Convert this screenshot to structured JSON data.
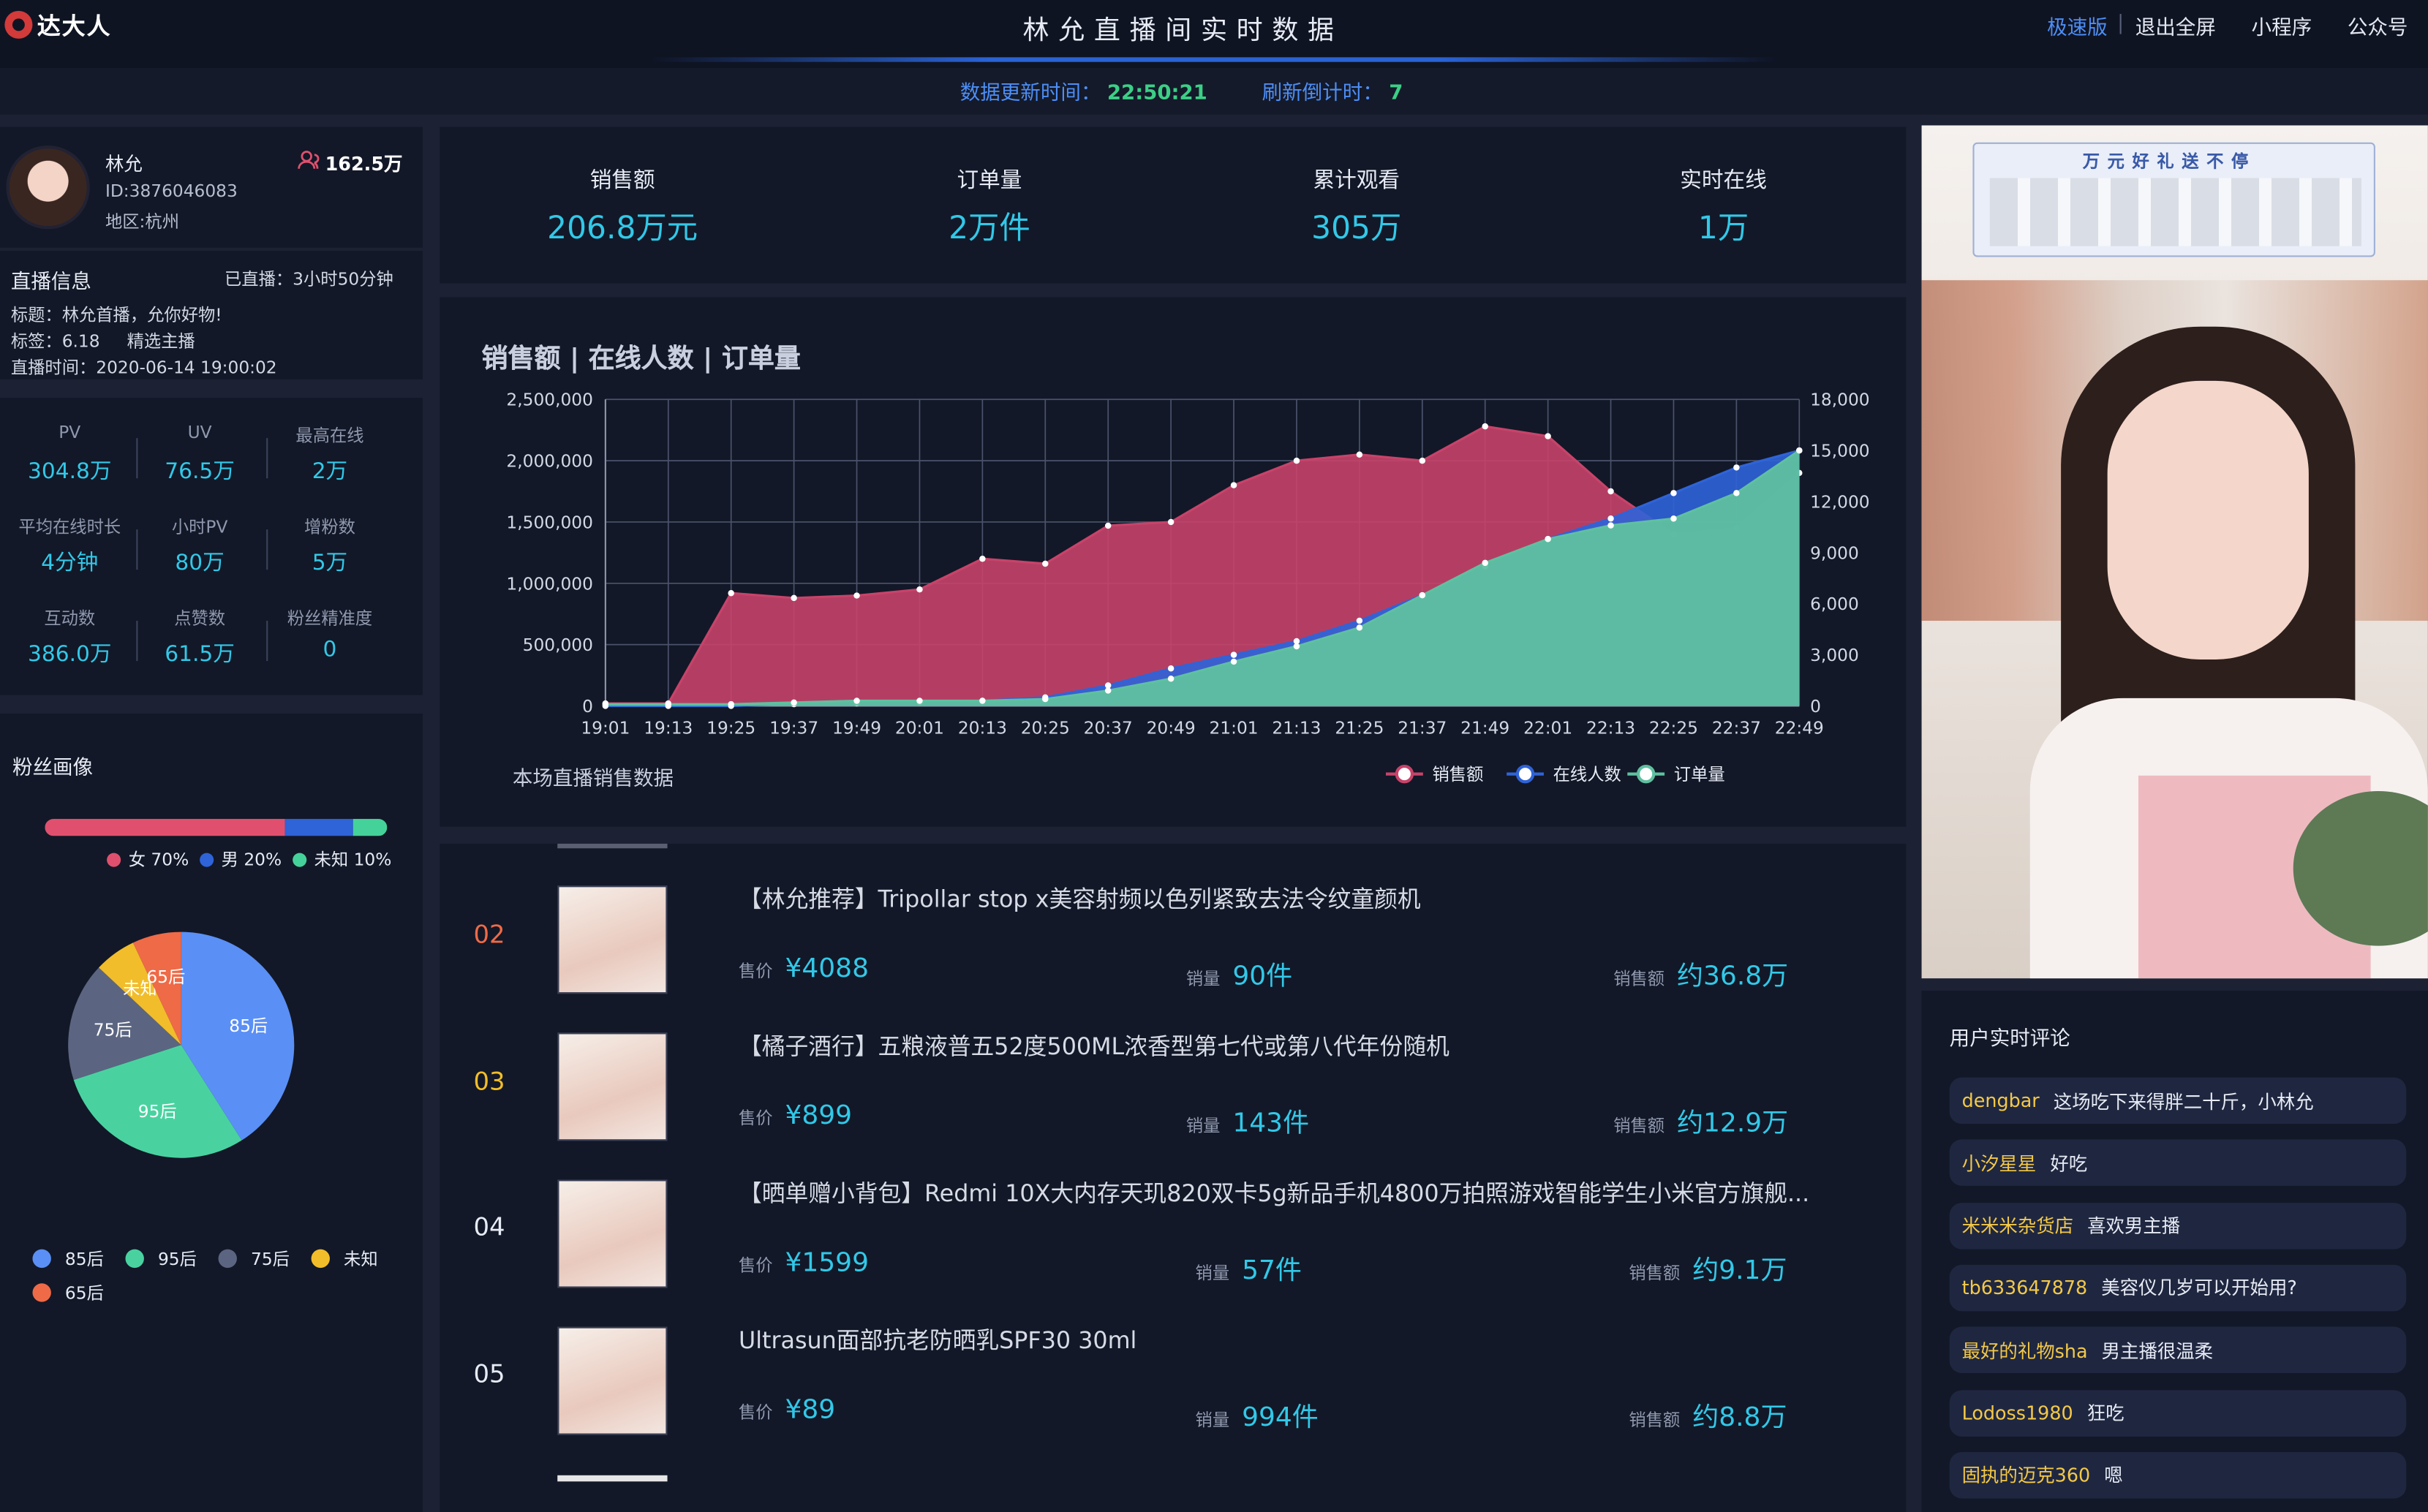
{
  "header": {
    "logo": "达大人",
    "title": "林允直播间实时数据",
    "nav": [
      "极速版",
      "退出全屏",
      "小程序",
      "公众号"
    ]
  },
  "status": {
    "update_label": "数据更新时间：",
    "update_time": "22:50:21",
    "countdown_label": "刷新倒计时：",
    "countdown": "7"
  },
  "streamer": {
    "name": "林允",
    "id": "ID:3876046083",
    "area": "地区:杭州",
    "fans": "162.5万"
  },
  "live_info": {
    "heading": "直播信息",
    "duration": "已直播：3小时50分钟",
    "title": "标题：林允首播，允你好物!",
    "tags": "标签：6.18     精选主播",
    "time": "直播时间：2020-06-14 19:00:02"
  },
  "metrics": [
    {
      "label": "PV",
      "value": "304.8万"
    },
    {
      "label": "UV",
      "value": "76.5万"
    },
    {
      "label": "最高在线",
      "value": "2万"
    },
    {
      "label": "平均在线时长",
      "value": "4分钟"
    },
    {
      "label": "小时PV",
      "value": "80万"
    },
    {
      "label": "增粉数",
      "value": "5万"
    },
    {
      "label": "互动数",
      "value": "386.0万"
    },
    {
      "label": "点赞数",
      "value": "61.5万"
    },
    {
      "label": "粉丝精准度",
      "value": "0"
    }
  ],
  "fans": {
    "heading": "粉丝画像",
    "gender": [
      {
        "label": "女 70%",
        "pct": 70,
        "color": "#e0506e"
      },
      {
        "label": "男 20%",
        "pct": 20,
        "color": "#2f63d8"
      },
      {
        "label": "未知 10%",
        "pct": 10,
        "color": "#45d29a"
      }
    ],
    "age": [
      {
        "label": "85后",
        "pct": 41,
        "color": "#5a8ff5"
      },
      {
        "label": "95后",
        "pct": 29,
        "color": "#49d2a0"
      },
      {
        "label": "75后",
        "pct": 17,
        "color": "#5b6581"
      },
      {
        "label": "未知",
        "pct": 6,
        "color": "#f2bd2a"
      },
      {
        "label": "65后",
        "pct": 7,
        "color": "#ef6a47"
      }
    ]
  },
  "stats": [
    {
      "label": "销售额",
      "value": "206.8万元"
    },
    {
      "label": "订单量",
      "value": "2万件"
    },
    {
      "label": "累计观看",
      "value": "305万"
    },
    {
      "label": "实时在线",
      "value": "1万"
    }
  ],
  "chart_data": {
    "type": "area",
    "title": "销售额 | 在线人数 | 订单量",
    "subtitle": "本场直播销售数据",
    "x": [
      "19:01",
      "19:13",
      "19:25",
      "19:37",
      "19:49",
      "20:01",
      "20:13",
      "20:25",
      "20:37",
      "20:49",
      "21:01",
      "21:13",
      "21:25",
      "21:37",
      "21:49",
      "22:01",
      "22:13",
      "22:25",
      "22:37",
      "22:49"
    ],
    "y_left": {
      "ticks": [
        "0",
        "500,000",
        "1,000,000",
        "1,500,000",
        "2,000,000",
        "2,500,000"
      ],
      "range": [
        0,
        2500000
      ]
    },
    "y_right": {
      "ticks": [
        "0",
        "3,000",
        "6,000",
        "9,000",
        "12,000",
        "15,000",
        "18,000"
      ],
      "range": [
        0,
        18000
      ]
    },
    "series": [
      {
        "name": "销售额",
        "axis": "left",
        "color": "#c7436a",
        "values": [
          20000,
          20000,
          920000,
          880000,
          900000,
          950000,
          1200000,
          1160000,
          1470000,
          1500000,
          1800000,
          2000000,
          2050000,
          2000000,
          2280000,
          2200000,
          1750000,
          1400000,
          1450000,
          1900000
        ]
      },
      {
        "name": "在线人数",
        "axis": "right",
        "color": "#2f63d8",
        "values": [
          0,
          0,
          0,
          100,
          150,
          200,
          300,
          500,
          1200,
          2200,
          3000,
          3800,
          5000,
          6500,
          8200,
          9800,
          11000,
          12500,
          14000,
          15000
        ]
      },
      {
        "name": "订单量",
        "axis": "right",
        "color": "#5fc0a0",
        "values": [
          100,
          100,
          100,
          200,
          300,
          300,
          300,
          400,
          900,
          1600,
          2600,
          3500,
          4600,
          6500,
          8400,
          9800,
          10600,
          11000,
          12500,
          15000
        ]
      }
    ],
    "grid": true,
    "legend": "bottom-right"
  },
  "products": [
    {
      "rank": "02",
      "rank_color": "#ef6a47",
      "title": "【林允推荐】Tripollar stop x美容射频以色列紧致去法令纹童颜机",
      "price_label": "售价",
      "price": "¥4088",
      "sales_label": "销量",
      "sales": "90件",
      "rev_label": "销售额",
      "rev": "约36.8万"
    },
    {
      "rank": "03",
      "rank_color": "#f2bd2a",
      "title": "【橘子酒行】五粮液普五52度500ML浓香型第七代或第八代年份随机",
      "price_label": "售价",
      "price": "¥899",
      "sales_label": "销量",
      "sales": "143件",
      "rev_label": "销售额",
      "rev": "约12.9万"
    },
    {
      "rank": "04",
      "rank_color": "#e7ebf5",
      "title": "【晒单赠小背包】Redmi 10X大内存天玑820双卡5g新品手机4800万拍照游戏智能学生小米官方旗舰...",
      "price_label": "售价",
      "price": "¥1599",
      "sales_label": "销量",
      "sales": "57件",
      "rev_label": "销售额",
      "rev": "约9.1万"
    },
    {
      "rank": "05",
      "rank_color": "#e7ebf5",
      "title": "Ultrasun面部抗老防晒乳SPF30 30ml",
      "price_label": "售价",
      "price": "¥89",
      "sales_label": "销量",
      "sales": "994件",
      "rev_label": "销售额",
      "rev": "约8.8万"
    }
  ],
  "video": {
    "banner": "万元好礼送不停"
  },
  "comments": {
    "heading": "用户实时评论",
    "items": [
      {
        "user": "dengbar",
        "text": "这场吃下来得胖二十斤，小林允"
      },
      {
        "user": "小汐星星",
        "text": "好吃"
      },
      {
        "user": "米米米杂货店",
        "text": "喜欢男主播"
      },
      {
        "user": "tb633647878",
        "text": "美容仪几岁可以开始用?"
      },
      {
        "user": "最好的礼物sha",
        "text": "男主播很温柔"
      },
      {
        "user": "Lodoss1980",
        "text": "狂吃"
      },
      {
        "user": "固执的迈克360",
        "text": "嗯"
      }
    ]
  }
}
